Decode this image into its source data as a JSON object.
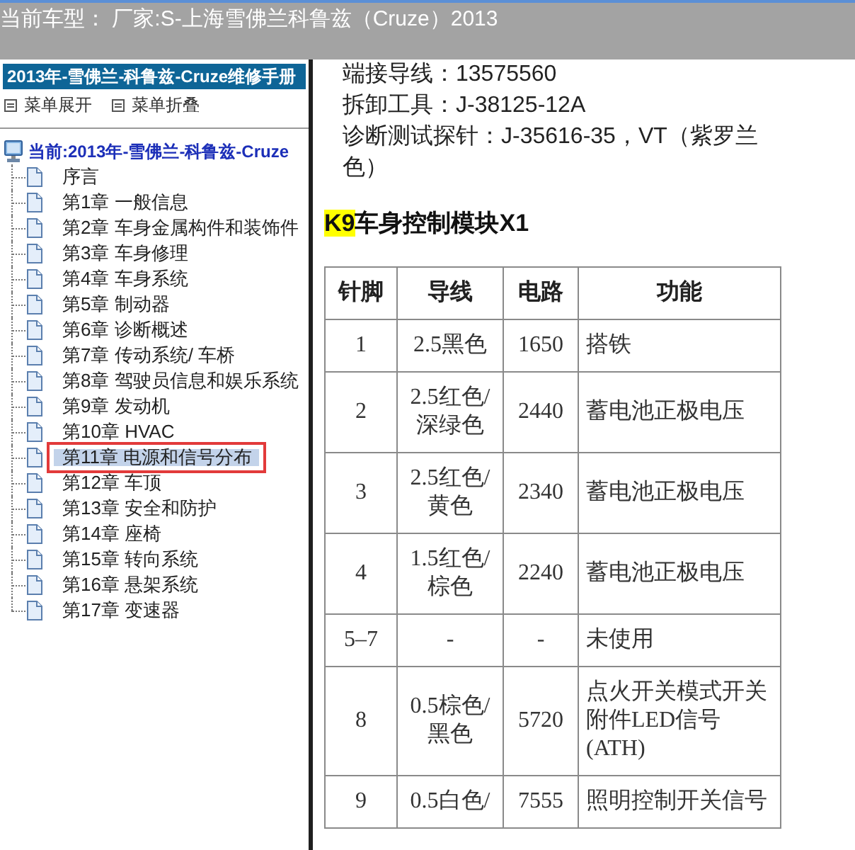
{
  "header_bar": {
    "text": "当前车型： 厂家:S-上海雪佛兰科鲁兹（Cruze）2013"
  },
  "sidebar": {
    "title": "2013年-雪佛兰-科鲁兹-Cruze维修手册",
    "menu_actions": [
      {
        "label": "菜单展开"
      },
      {
        "label": "菜单折叠"
      }
    ],
    "tree": {
      "label": "当前:2013年-雪佛兰-科鲁兹-Cruze",
      "selected": false,
      "children": [
        {
          "label": "序言",
          "selected": false
        },
        {
          "label": "第1章 一般信息",
          "selected": false
        },
        {
          "label": "第2章 车身金属构件和装饰件",
          "selected": false
        },
        {
          "label": "第3章 车身修理",
          "selected": false
        },
        {
          "label": "第4章 车身系统",
          "selected": false
        },
        {
          "label": "第5章 制动器",
          "selected": false
        },
        {
          "label": "第6章 诊断概述",
          "selected": false
        },
        {
          "label": "第7章 传动系统/ 车桥",
          "selected": false
        },
        {
          "label": "第8章 驾驶员信息和娱乐系统",
          "selected": false
        },
        {
          "label": "第9章 发动机",
          "selected": false
        },
        {
          "label": "第10章 HVAC",
          "selected": false
        },
        {
          "label": "第11章 电源和信号分布",
          "selected": true
        },
        {
          "label": "第12章 车顶",
          "selected": false
        },
        {
          "label": "第13章 安全和防护",
          "selected": false
        },
        {
          "label": "第14章 座椅",
          "selected": false
        },
        {
          "label": "第15章 转向系统",
          "selected": false
        },
        {
          "label": "第16章 悬架系统",
          "selected": false
        },
        {
          "label": "第17章 变速器",
          "selected": false
        }
      ]
    }
  },
  "content": {
    "spec_lines": [
      "端接导线：13575560",
      "拆卸工具：J-38125-12A",
      "诊断测试探针：J-35616-35，VT（紫罗兰色）"
    ],
    "heading": {
      "highlight": "K9",
      "text": "车身控制模块X1"
    },
    "table": {
      "columns": [
        "针脚",
        "导线",
        "电路",
        "功能"
      ],
      "rows": [
        [
          "1",
          "2.5黑色",
          "1650",
          "搭铁"
        ],
        [
          "2",
          "2.5红色/深绿色",
          "2440",
          "蓄电池正极电压"
        ],
        [
          "3",
          "2.5红色/黄色",
          "2340",
          "蓄电池正极电压"
        ],
        [
          "4",
          "1.5红色/棕色",
          "2240",
          "蓄电池正极电压"
        ],
        [
          "5–7",
          "-",
          "-",
          "未使用"
        ],
        [
          "8",
          "0.5棕色/黑色",
          "5720",
          "点火开关模式开关附件LED信号(ATH)"
        ],
        [
          "9",
          "0.5白色/",
          "7555",
          "照明控制开关信号"
        ]
      ]
    }
  }
}
